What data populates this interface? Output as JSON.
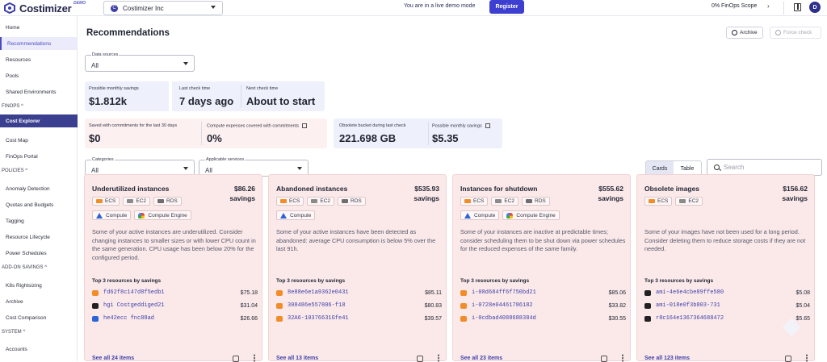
{
  "topbar": {
    "logo_text": "Costimizer",
    "logo_badge": "DEMO",
    "org_initial": "C",
    "org_name": "Costimizer Inc",
    "demo_message": "You are in a live demo mode",
    "register_label": "Register",
    "scope_label": "0% FinOps Scope",
    "avatar_initial": "D"
  },
  "sidebar": {
    "items": [
      {
        "label": "Home",
        "type": "item"
      },
      {
        "label": "Recommendations",
        "type": "active"
      },
      {
        "label": "Resources",
        "type": "item"
      },
      {
        "label": "Pools",
        "type": "item"
      },
      {
        "label": "Shared Environments",
        "type": "item"
      },
      {
        "label": "FINOPS ^",
        "type": "section"
      },
      {
        "label": "Cost Explorer",
        "type": "highlight"
      },
      {
        "label": "Cost Map",
        "type": "item"
      },
      {
        "label": "FinOps Portal",
        "type": "item"
      },
      {
        "label": "POLICIES ^",
        "type": "section"
      },
      {
        "label": "Anomaly Detection",
        "type": "item"
      },
      {
        "label": "Quotas and Budgets",
        "type": "item"
      },
      {
        "label": "Tagging",
        "type": "item"
      },
      {
        "label": "Resource Lifecycle",
        "type": "item"
      },
      {
        "label": "Power Schedules",
        "type": "item"
      },
      {
        "label": "ADD-ON SAVINGS ^",
        "type": "section"
      },
      {
        "label": "K8s Rightsizing",
        "type": "item"
      },
      {
        "label": "Archive",
        "type": "item"
      },
      {
        "label": "Cost Comparison",
        "type": "item"
      },
      {
        "label": "SYSTEM ^",
        "type": "section"
      },
      {
        "label": "Accounts",
        "type": "item"
      }
    ]
  },
  "main": {
    "title": "Recommendations",
    "archive_label": "Archive",
    "force_check_label": "Force check",
    "data_sources": {
      "label": "Data sources",
      "value": "All"
    },
    "categories": {
      "label": "Categories",
      "value": "All"
    },
    "applicable_services": {
      "label": "Applicable services",
      "value": "All"
    },
    "stats_top": [
      {
        "label": "Possible monthly savings",
        "value": "$1.812k"
      },
      {
        "label": "Last check time",
        "value": "7 days ago"
      },
      {
        "label": "Next check time",
        "value": "About to start"
      }
    ],
    "stats_commit": [
      {
        "label": "Saved with commitments for the last 30 days",
        "value": "$0"
      },
      {
        "label": "Compute expenses covered with commitments",
        "value": "0%"
      }
    ],
    "stats_bucket": [
      {
        "label": "Obsolete bucket during last check",
        "value": "221.698 GB"
      },
      {
        "label": "Possible monthly savings",
        "value": "$5.35"
      }
    ],
    "view_cards": "Cards",
    "view_table": "Table",
    "search_placeholder": "Search"
  },
  "cards": [
    {
      "title": "Underutilized instances",
      "amount": "$86.26",
      "amount_suffix": "savings",
      "chips": [
        "ECS",
        "EC2",
        "RDS"
      ],
      "services": [
        "Compute",
        "Compute Engine"
      ],
      "description": "Some of your active instances are underutilized. Consider changing instances to smaller sizes or with lower CPU count in the same generation. CPU usage has been below 20% for the configured period.",
      "top_label": "Top 3 resources by savings",
      "resources": [
        {
          "name": "fd62f8c147d8f5edb1",
          "amount": "$75.18",
          "icon": "orange"
        },
        {
          "name": "hgi Costgeddiged21",
          "amount": "$31.04",
          "icon": "black"
        },
        {
          "name": "he42ecc fnc88ad",
          "amount": "$26.66",
          "icon": "blue"
        }
      ],
      "see_all": "See all 24 items"
    },
    {
      "title": "Abandoned instances",
      "amount": "$535.93",
      "amount_suffix": "savings",
      "chips": [
        "ECS",
        "EC2",
        "RDS"
      ],
      "services": [
        "Compute"
      ],
      "description": "Some of your active instances have been detected as abandoned: average CPU consumption is below 5% over the last 91h.",
      "top_label": "Top 3 resources by savings",
      "resources": [
        {
          "name": "8e88e6e1a9362e0431",
          "amount": "$85.11",
          "icon": "orange"
        },
        {
          "name": "308486e557806-f18",
          "amount": "$80.83",
          "icon": "orange"
        },
        {
          "name": "32A6-10376631Gfe41",
          "amount": "$39.57",
          "icon": "orange"
        }
      ],
      "see_all": "See all 13 items"
    },
    {
      "title": "Instances for shutdown",
      "amount": "$555.62",
      "amount_suffix": "savings",
      "chips": [
        "ECS",
        "EC2",
        "RDS"
      ],
      "services": [
        "Compute",
        "Compute Engine"
      ],
      "description": "Some of your instances are inactive at predictable times; consider scheduling them to be shut down via power schedules for the reduced expenses of the same family.",
      "top_label": "Top 3 resources by savings",
      "resources": [
        {
          "name": "i-08d684ff6f750bd21",
          "amount": "$85.06",
          "icon": "orange"
        },
        {
          "name": "i-0728e04461786182",
          "amount": "$33.82",
          "icon": "orange"
        },
        {
          "name": "i-0cdbad4088688384d",
          "amount": "$30.55",
          "icon": "orange"
        }
      ],
      "see_all": "See all 23 items"
    },
    {
      "title": "Obsolete images",
      "amount": "$156.62",
      "amount_suffix": "savings",
      "chips": [
        "ECS",
        "EC2"
      ],
      "services": [],
      "description": "Some of your images have not been used for a long period. Consider deleting them to reduce storage costs if they are not needed.",
      "top_label": "Top 3 resources by savings",
      "resources": [
        {
          "name": "ami-4e6e4cbe89ffe580",
          "amount": "$5.08",
          "icon": "black"
        },
        {
          "name": "ami-018e0f3b803-731",
          "amount": "$5.04",
          "icon": "black"
        },
        {
          "name": "r8c164e1367364688472",
          "amount": "$5.65",
          "icon": "black"
        }
      ],
      "see_all": "See all 123 items"
    }
  ],
  "colors": {
    "accent": "#3d3fd1",
    "sidebar_highlight": "#3b3f8f",
    "card_bg": "#fbe9ea"
  }
}
